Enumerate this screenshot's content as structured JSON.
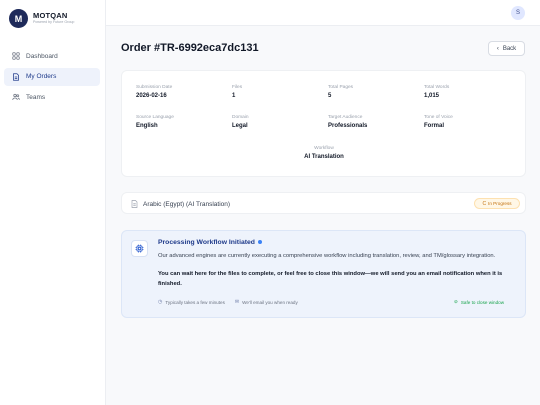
{
  "brand": {
    "logo_letter": "M",
    "name": "MOTQAN",
    "tagline": "Powered by Future Group"
  },
  "sidebar": {
    "items": [
      {
        "label": "Dashboard",
        "icon": "grid-icon",
        "active": false
      },
      {
        "label": "My Orders",
        "icon": "document-icon",
        "active": true
      },
      {
        "label": "Teams",
        "icon": "users-icon",
        "active": false
      }
    ]
  },
  "topbar": {
    "avatar_letter": "S"
  },
  "header": {
    "title": "Order #TR-6992eca7dc131",
    "back_label": "Back"
  },
  "details": {
    "submission_date": {
      "label": "Submission Date",
      "value": "2026-02-16"
    },
    "files": {
      "label": "Files",
      "value": "1"
    },
    "total_pages": {
      "label": "Total Pages",
      "value": "5"
    },
    "total_words": {
      "label": "Total Words",
      "value": "1,015"
    },
    "source_language": {
      "label": "Source Language",
      "value": "English"
    },
    "domain": {
      "label": "Domain",
      "value": "Legal"
    },
    "target_audience": {
      "label": "Target Audience",
      "value": "Professionals"
    },
    "tone_of_voice": {
      "label": "Tone of Voice",
      "value": "Formal"
    },
    "workflow": {
      "label": "Workflow",
      "value": "AI Translation"
    }
  },
  "language_row": {
    "name": "Arabic (Egypt) (AI Translation)",
    "status": "In Progress"
  },
  "processing": {
    "title": "Processing Workflow Initiated",
    "description": "Our advanced engines are currently executing a comprehensive workflow including translation, review, and TM/glossary integration.",
    "note": "You can wait here for the files to complete, or feel free to close this window—we will send you an email notification when it is finished.",
    "eta": "Typically takes a few minutes",
    "email_note": "We'll email you when ready",
    "safe_note": "Safe to close window"
  },
  "colors": {
    "brand": "#1e2a5a",
    "accent": "#1e3a8a",
    "status": "#c2700c",
    "safe": "#16a34a"
  }
}
